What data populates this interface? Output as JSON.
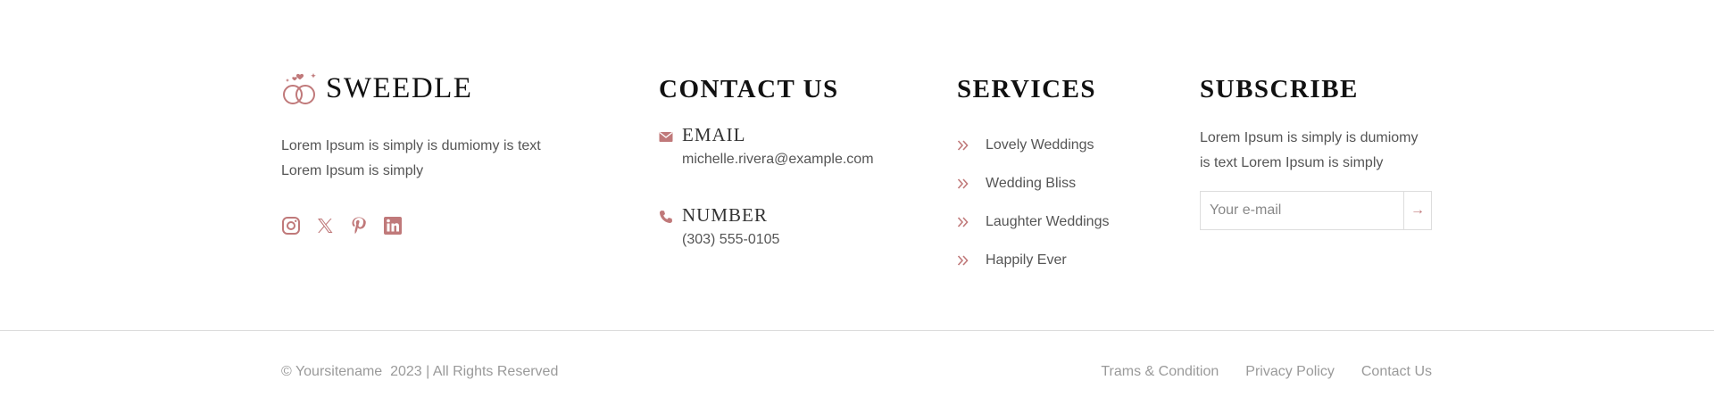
{
  "colors": {
    "accent": "#c0797a",
    "heading": "#111111",
    "text": "#555555",
    "muted": "#9a9a9a",
    "divider": "#dcdcdc"
  },
  "brand": {
    "logo_icon": "wedding-rings-icon",
    "name": "SWEEDLE",
    "description_line1": "Lorem Ipsum is simply is dumiomy is text",
    "description_line2": "Lorem Ipsum is simply",
    "social": [
      {
        "icon": "instagram-icon"
      },
      {
        "icon": "x-twitter-icon"
      },
      {
        "icon": "pinterest-icon"
      },
      {
        "icon": "linkedin-icon"
      }
    ]
  },
  "contact": {
    "heading": "CONTACT US",
    "email": {
      "icon": "envelope-icon",
      "label": "EMAIL",
      "value": "michelle.rivera@example.com"
    },
    "phone": {
      "icon": "phone-icon",
      "label": "NUMBER",
      "value": "(303) 555-0105"
    }
  },
  "services": {
    "heading": "SERVICES",
    "items": [
      {
        "label": "Lovely Weddings",
        "icon": "double-chevron-right-icon"
      },
      {
        "label": "Wedding Bliss",
        "icon": "double-chevron-right-icon"
      },
      {
        "label": "Laughter Weddings",
        "icon": "double-chevron-right-icon"
      },
      {
        "label": "Happily Ever",
        "icon": "double-chevron-right-icon"
      }
    ]
  },
  "subscribe": {
    "heading": "SUBSCRIBE",
    "text_line1": "Lorem Ipsum is simply is dumiomy",
    "text_line2": "is text Lorem Ipsum is simply",
    "input_placeholder": "Your e-mail",
    "submit_icon": "arrow-right-icon",
    "submit_glyph": "→"
  },
  "footer": {
    "copyright": "© Yoursitename  2023 | All Rights Reserved",
    "links": [
      "Trams & Condition",
      "Privacy Policy",
      "Contact Us"
    ]
  }
}
